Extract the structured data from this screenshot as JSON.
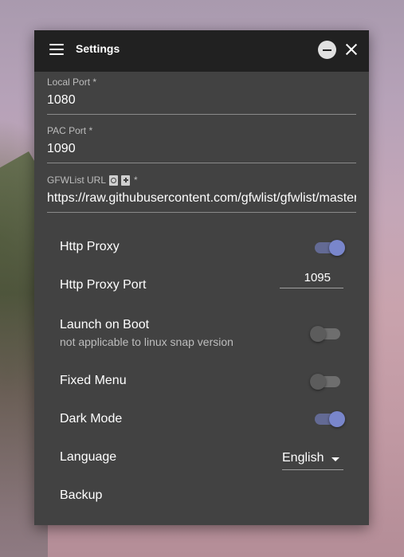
{
  "window": {
    "title": "Settings"
  },
  "fields": {
    "local_port": {
      "label": "Local Port *",
      "value": "1080"
    },
    "pac_port": {
      "label": "PAC Port *",
      "value": "1090"
    },
    "gfwlist_url": {
      "label": "GFWList URL",
      "required": "*",
      "value": "https://raw.githubusercontent.com/gfwlist/gfwlist/master/gfwlist.txt"
    }
  },
  "settings": {
    "http_proxy": {
      "label": "Http Proxy",
      "enabled": true
    },
    "http_proxy_port": {
      "label": "Http Proxy Port",
      "value": "1095"
    },
    "launch_on_boot": {
      "label": "Launch on Boot",
      "sub": "not applicable to linux snap version",
      "enabled": false
    },
    "fixed_menu": {
      "label": "Fixed Menu",
      "enabled": false
    },
    "dark_mode": {
      "label": "Dark Mode",
      "enabled": true
    },
    "language": {
      "label": "Language",
      "value": "English"
    },
    "backup": {
      "label": "Backup"
    }
  },
  "colors": {
    "accent": "#7986cb",
    "titlebar": "#212121",
    "panel": "#424242"
  },
  "icons": [
    "menu-icon",
    "minimize-icon",
    "close-icon",
    "refresh-file-icon",
    "add-file-icon",
    "chevron-down-icon"
  ]
}
